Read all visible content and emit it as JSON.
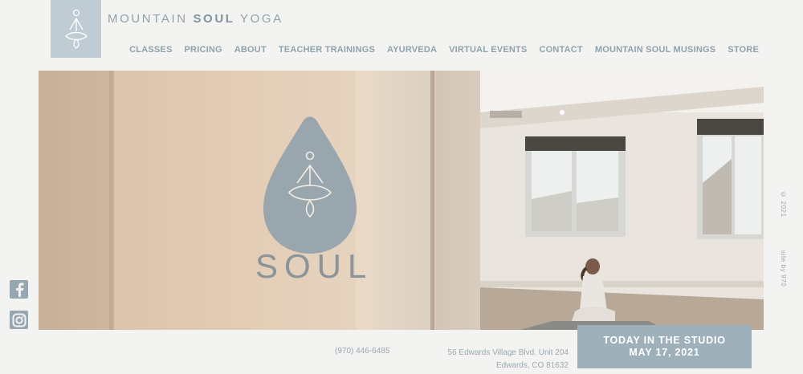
{
  "brand": {
    "prefix": "MOUNTAIN ",
    "bold": "SOUL",
    "suffix": " YOGA"
  },
  "nav": [
    {
      "label": "CLASSES"
    },
    {
      "label": "PRICING"
    },
    {
      "label": "ABOUT"
    },
    {
      "label": "TEACHER TRAININGS"
    },
    {
      "label": "AYURVEDA"
    },
    {
      "label": "VIRTUAL EVENTS"
    },
    {
      "label": "CONTACT"
    },
    {
      "label": "MOUNTAIN SOUL MUSINGS"
    },
    {
      "label": "STORE"
    }
  ],
  "hero": {
    "sign_text": "SOUL"
  },
  "side": {
    "copyright": "© 2021",
    "credit": "site by 970"
  },
  "social": {
    "facebook_icon": "facebook-icon",
    "instagram_icon": "instagram-icon"
  },
  "footer": {
    "phone": "(970) 446-6485",
    "address_line1": "56 Edwards Village Blvd. Unit 204",
    "address_line2": "Edwards, CO 81632"
  },
  "studio": {
    "line1": "TODAY IN THE STUDIO",
    "line2": "MAY 17, 2021"
  },
  "colors": {
    "accent": "#9eb0ba",
    "logo_bg": "#bfccd3",
    "text": "#8ea3ad"
  }
}
